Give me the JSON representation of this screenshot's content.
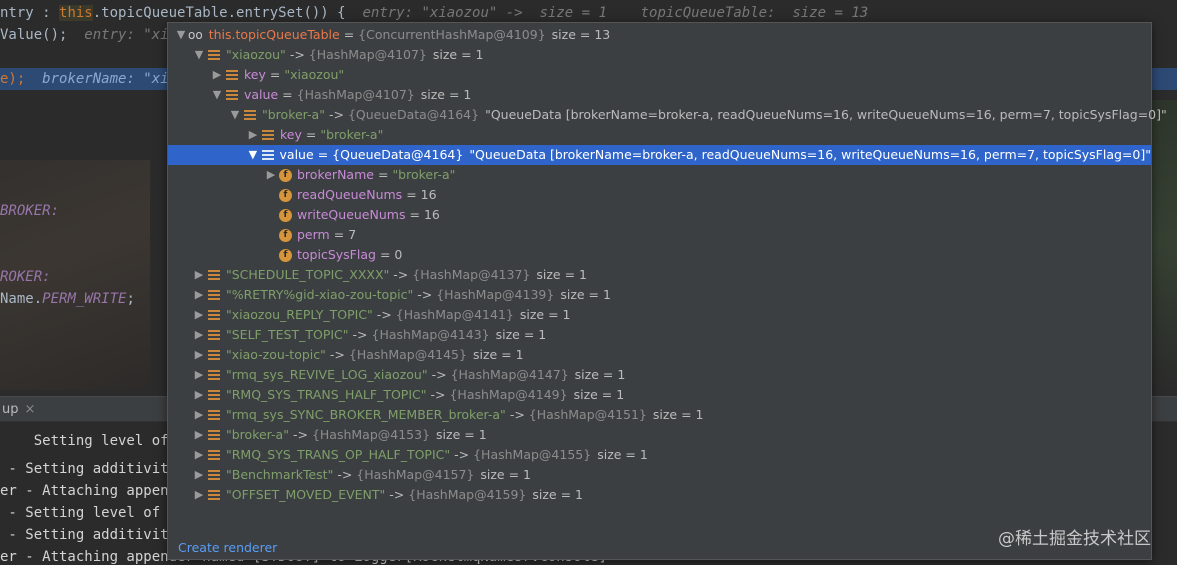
{
  "editor": {
    "line1": {
      "a": "ntry : ",
      "this": "this",
      "b": ".topicQueueTable.entrySet()) {",
      "hint": "  entry: \"xiaozou\" ->  size = 1    topicQueueTable:  size = 13"
    },
    "line2": {
      "a": "Value();",
      "hint": "  entry: \"xi"
    },
    "line3": {
      "a": "e);",
      "hint": "  brokerName: \"xi"
    },
    "line4": {
      "a": "BROKER:"
    },
    "line5": {
      "a": "ROKER:"
    },
    "line6": {
      "a": "Name.",
      "b": "PERM_WRITE",
      "c": ";"
    }
  },
  "panel": {
    "tab_label": "up",
    "close": "×"
  },
  "console": {
    "lines": [
      "    Setting level of l",
      " - Setting additivity",
      "er - Attaching append",
      " - Setting level of l",
      " - Setting additivity",
      "er - Attaching appender named [STDOUT] to Logger[RocketmqNamesrvConsole]"
    ]
  },
  "popup": {
    "root": {
      "name": "this.topicQueueTable",
      "type": "{ConcurrentHashMap@4109}",
      "size": "size = 13"
    },
    "entry": {
      "key": "\"xiaozou\"",
      "type": "{HashMap@4107}",
      "size": "size = 1"
    },
    "entry_key": {
      "name": "key",
      "value": "\"xiaozou\""
    },
    "entry_value": {
      "name": "value",
      "type": "{HashMap@4107}",
      "size": "size = 1"
    },
    "inner": {
      "key": "\"broker-a\"",
      "type": "{QueueData@4164}",
      "text": "\"QueueData [brokerName=broker-a, readQueueNums=16, writeQueueNums=16, perm=7, topicSysFlag=0]\""
    },
    "inner_key": {
      "name": "key",
      "value": "\"broker-a\""
    },
    "inner_value": {
      "name": "value",
      "type": "{QueueData@4164}",
      "text": "\"QueueData [brokerName=broker-a, readQueueNums=16, writeQueueNums=16, perm=7, topicSysFlag=0]\""
    },
    "fields": [
      {
        "name": "brokerName",
        "value": "\"broker-a\"",
        "is_string": true,
        "expandable": true
      },
      {
        "name": "readQueueNums",
        "value": "16",
        "is_string": false,
        "expandable": false
      },
      {
        "name": "writeQueueNums",
        "value": "16",
        "is_string": false,
        "expandable": false
      },
      {
        "name": "perm",
        "value": "7",
        "is_string": false,
        "expandable": false
      },
      {
        "name": "topicSysFlag",
        "value": "0",
        "is_string": false,
        "expandable": false
      }
    ],
    "topics": [
      {
        "key": "\"SCHEDULE_TOPIC_XXXX\"",
        "type": "{HashMap@4137}",
        "size": "size = 1"
      },
      {
        "key": "\"%RETRY%gid-xiao-zou-topic\"",
        "type": "{HashMap@4139}",
        "size": "size = 1"
      },
      {
        "key": "\"xiaozou_REPLY_TOPIC\"",
        "type": "{HashMap@4141}",
        "size": "size = 1"
      },
      {
        "key": "\"SELF_TEST_TOPIC\"",
        "type": "{HashMap@4143}",
        "size": "size = 1"
      },
      {
        "key": "\"xiao-zou-topic\"",
        "type": "{HashMap@4145}",
        "size": "size = 1"
      },
      {
        "key": "\"rmq_sys_REVIVE_LOG_xiaozou\"",
        "type": "{HashMap@4147}",
        "size": "size = 1"
      },
      {
        "key": "\"RMQ_SYS_TRANS_HALF_TOPIC\"",
        "type": "{HashMap@4149}",
        "size": "size = 1"
      },
      {
        "key": "\"rmq_sys_SYNC_BROKER_MEMBER_broker-a\"",
        "type": "{HashMap@4151}",
        "size": "size = 1"
      },
      {
        "key": "\"broker-a\"",
        "type": "{HashMap@4153}",
        "size": "size = 1"
      },
      {
        "key": "\"RMQ_SYS_TRANS_OP_HALF_TOPIC\"",
        "type": "{HashMap@4155}",
        "size": "size = 1"
      },
      {
        "key": "\"BenchmarkTest\"",
        "type": "{HashMap@4157}",
        "size": "size = 1"
      },
      {
        "key": "\"OFFSET_MOVED_EVENT\"",
        "type": "{HashMap@4159}",
        "size": "size = 1"
      }
    ],
    "arrow": "->",
    "equals": "=",
    "create_renderer": "Create renderer",
    "icons": {
      "expanded": "chevron-down-icon",
      "collapsed": "chevron-right-icon",
      "field": "field-icon",
      "object": "object-field-icon",
      "watch": "glasses-icon"
    }
  },
  "watermark": "@稀土掘金技术社区",
  "colors": {
    "selection": "#2f65ca",
    "accent": "#589df6",
    "field_name": "#c88bd7",
    "string_value": "#7f9f6a"
  }
}
